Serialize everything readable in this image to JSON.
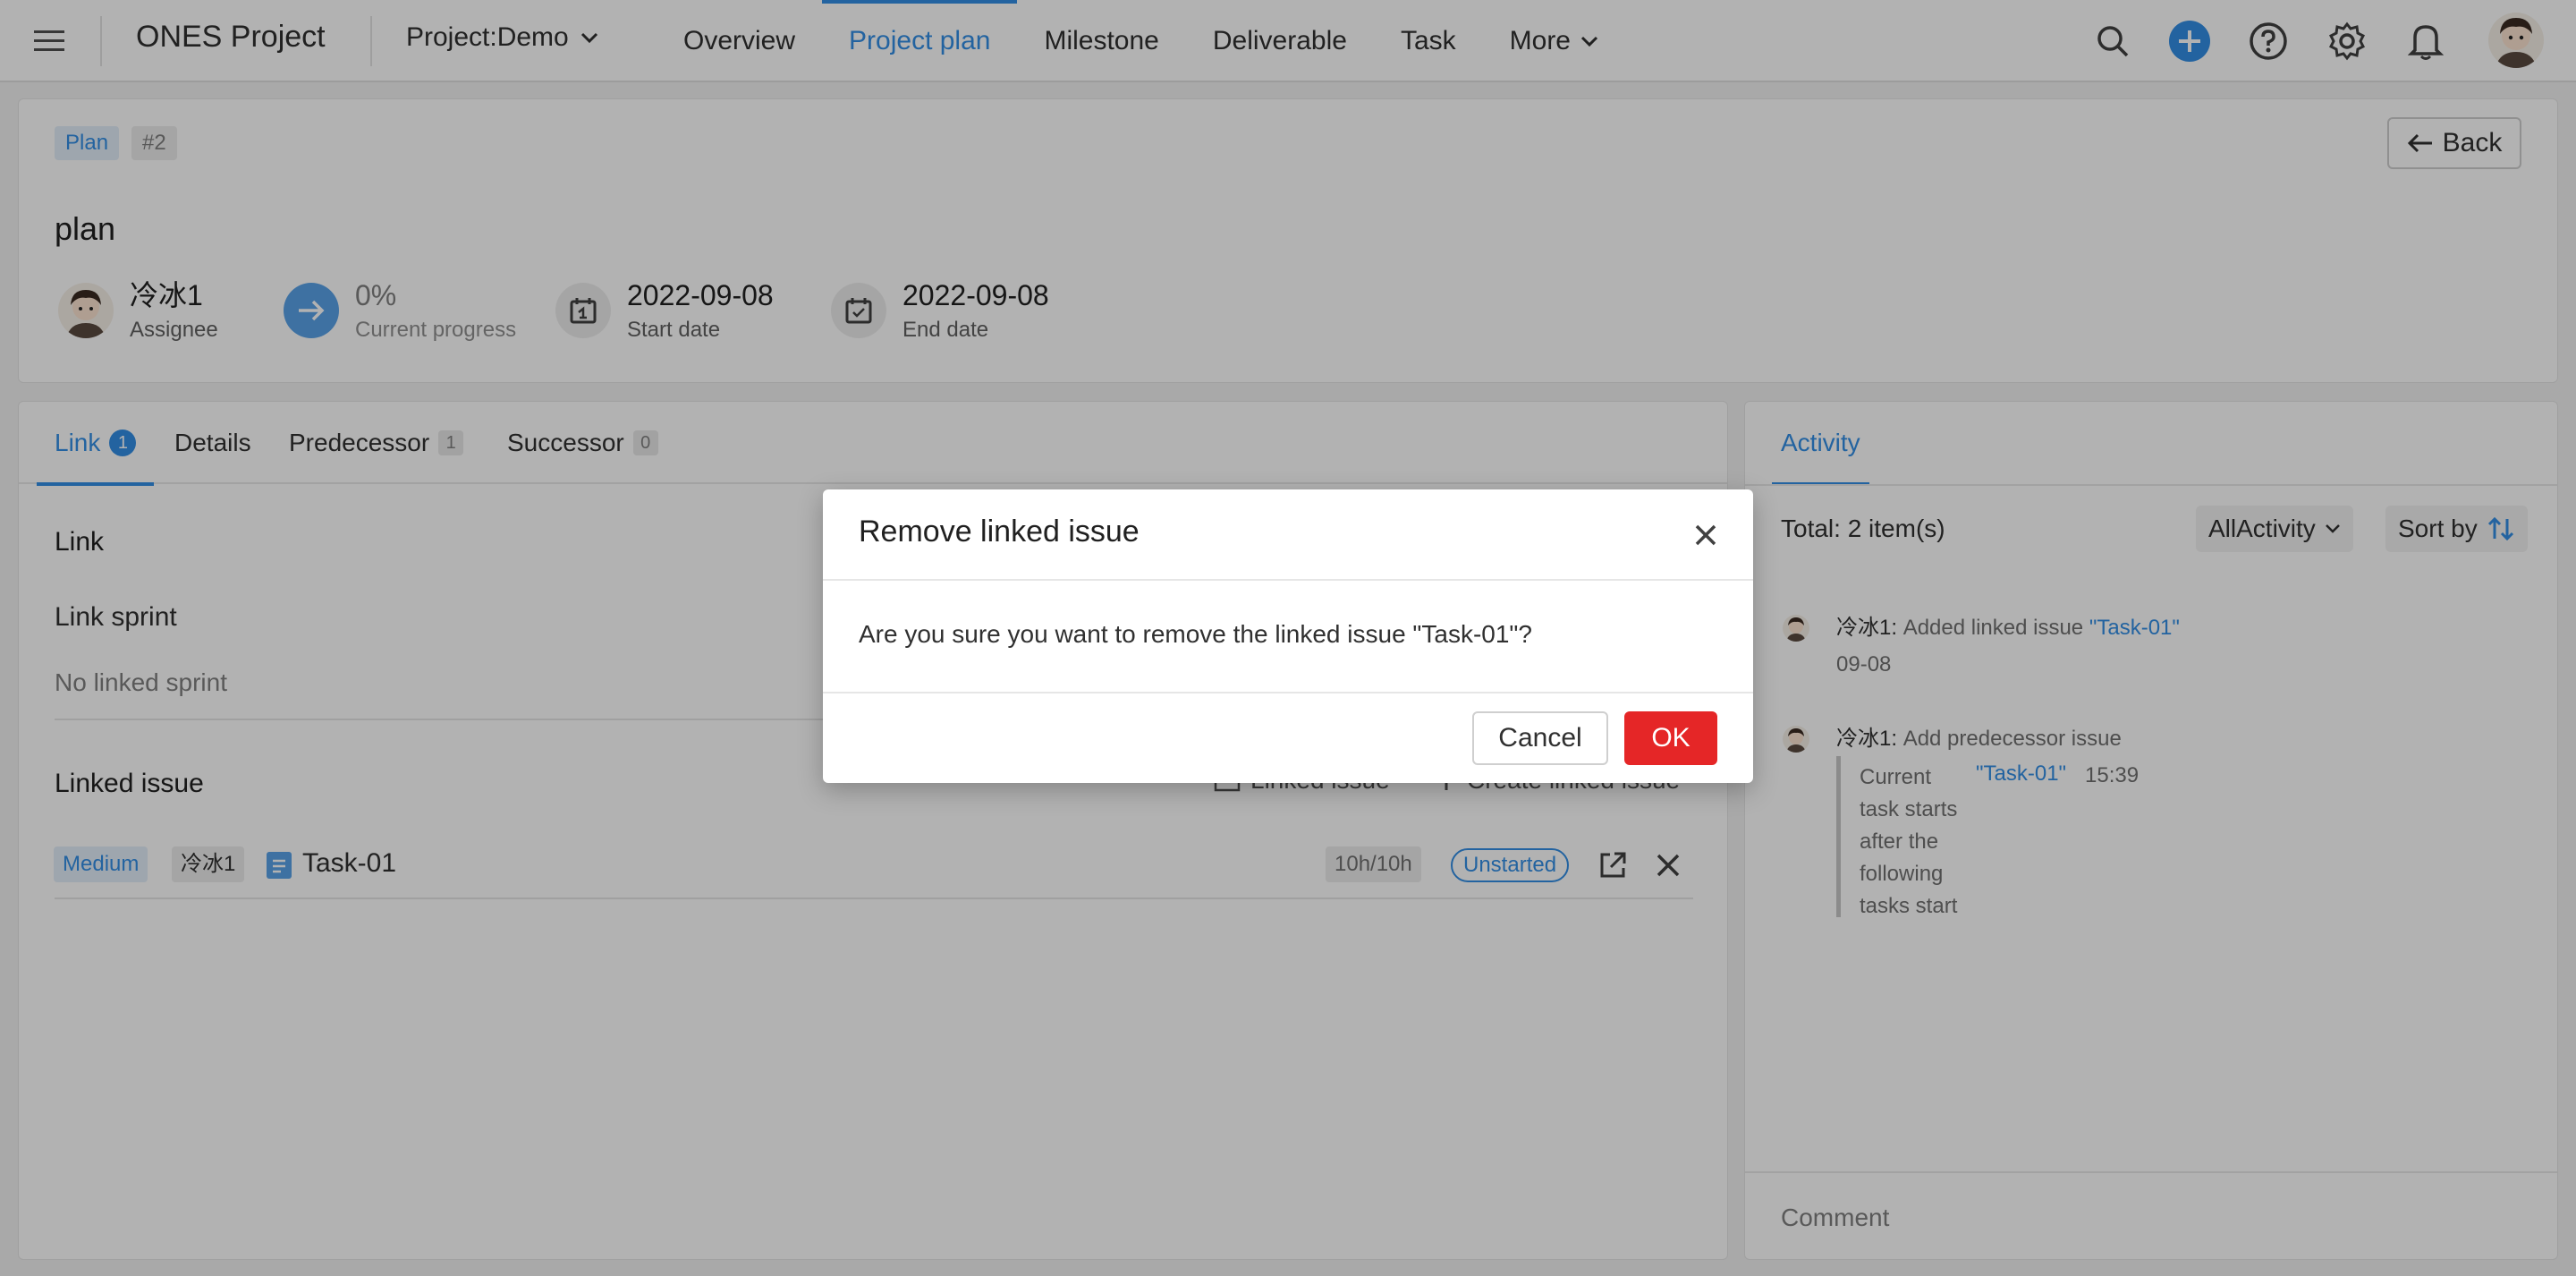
{
  "topnav": {
    "brand": "ONES Project",
    "project": "Project:Demo",
    "tabs": [
      "Overview",
      "Project plan",
      "Milestone",
      "Deliverable",
      "Task",
      "More"
    ],
    "active_tab": "Project plan"
  },
  "header": {
    "tag_type": "Plan",
    "tag_num": "#2",
    "back_label": "Back",
    "title": "plan",
    "assignee": {
      "value": "冷冰1",
      "label": "Assignee"
    },
    "progress": {
      "value": "0%",
      "label": "Current progress"
    },
    "start": {
      "value": "2022-09-08",
      "label": "Start date"
    },
    "end": {
      "value": "2022-09-08",
      "label": "End date"
    }
  },
  "left_panel": {
    "tabs": [
      {
        "label": "Link",
        "count": "1"
      },
      {
        "label": "Details",
        "count": ""
      },
      {
        "label": "Predecessor",
        "count": "1"
      },
      {
        "label": "Successor",
        "count": "0"
      }
    ],
    "link_title": "Link",
    "link_sprint_title": "Link sprint",
    "no_sprint": "No linked sprint",
    "linked_issue_title": "Linked issue",
    "linked_issue_btn": "Linked issue",
    "create_linked_btn": "Create linked issue",
    "row": {
      "priority": "Medium",
      "assignee": "冷冰1",
      "name": "Task-01",
      "hours": "10h/10h",
      "status": "Unstarted"
    }
  },
  "right_panel": {
    "tab": "Activity",
    "total": "Total: 2 item(s)",
    "filter": "AllActivity",
    "sort": "Sort by",
    "activities": [
      {
        "name": "冷冰1:",
        "text": "Added linked issue",
        "link": "\"Task-01\"",
        "time": "09-08"
      },
      {
        "name": "冷冰1:",
        "text": "Add predecessor issue",
        "detail": [
          "Current",
          "task starts",
          "after the",
          "following",
          "tasks start"
        ],
        "link": "\"Task-01\"",
        "time": "15:39"
      }
    ],
    "comment_placeholder": "Comment"
  },
  "modal": {
    "title": "Remove linked issue",
    "body": "Are you sure you want to remove the linked issue \"Task-01\"?",
    "cancel": "Cancel",
    "ok": "OK"
  },
  "colors": {
    "accent": "#338fe5",
    "danger": "#e52627",
    "overlay": "rgba(0,0,0,0.30)"
  }
}
